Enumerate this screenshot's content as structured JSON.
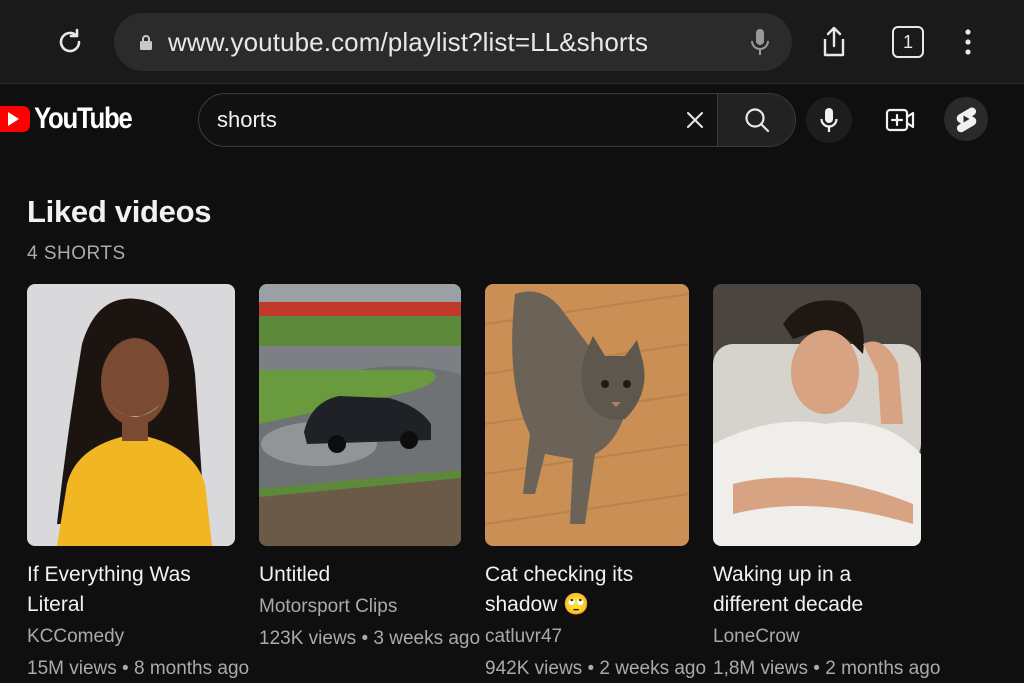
{
  "browser": {
    "url": "www.youtube.com/playlist?list=LL&shorts",
    "tab_count": "1"
  },
  "header": {
    "logo_text": "YouTube",
    "search": {
      "value": "shorts",
      "placeholder": "Search"
    }
  },
  "page": {
    "title": "Liked videos",
    "count": "4 SHORTS"
  },
  "videos": [
    {
      "title": "If Everything Was Literal",
      "channel": "KCComedy",
      "views": "15M views",
      "age": "8 months ago",
      "emoji": ""
    },
    {
      "title": "Untitled",
      "channel": "Motorsport Clips",
      "views": "123K views",
      "age": "3 weeks ago",
      "emoji": ""
    },
    {
      "title": "Cat checking its shadow",
      "channel": "catluvr47",
      "views": "942K views",
      "age": "2 weeks ago",
      "emoji": "🙄"
    },
    {
      "title": "Waking up in a different decade",
      "channel": "LoneCrow",
      "views": "1,8M views",
      "age": "2 months ago",
      "emoji": ""
    }
  ],
  "colors": {
    "brand_red": "#ff0000",
    "background": "#0f0f0f",
    "secondary_text": "#aaaaaa"
  },
  "icons": [
    "reload-icon",
    "lock-icon",
    "microphone-icon",
    "share-icon",
    "tab-switcher-icon",
    "more-vertical-icon",
    "youtube-logo-icon",
    "clear-icon",
    "search-icon",
    "create-video-icon",
    "shorts-icon"
  ]
}
